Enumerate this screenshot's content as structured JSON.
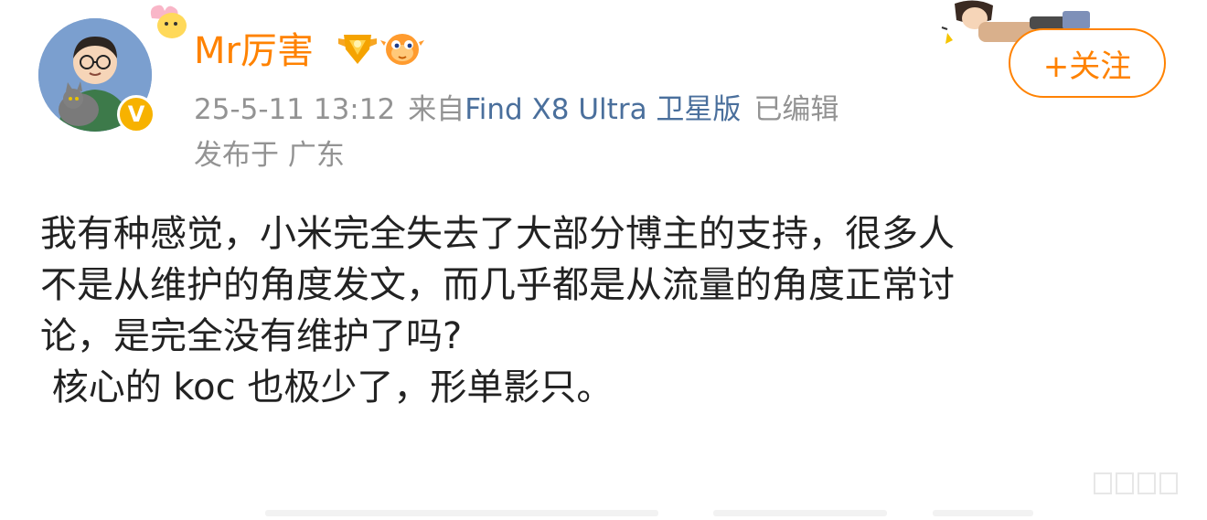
{
  "user": {
    "name": "Mr厉害",
    "verified_badge": "V",
    "badges": [
      "gold-wings-badge",
      "pufferfish-badge"
    ]
  },
  "meta": {
    "time": "25-5-11 13:12",
    "from_label": "来自",
    "device": "Find X8 Ultra 卫星版",
    "edited": "已编辑",
    "location": "发布于 广东"
  },
  "follow_button": {
    "label": "+关注"
  },
  "post": {
    "lines": [
      "我有种感觉，小米完全失去了大部分博主的支持，很多人",
      "不是从维护的角度发文，而几乎都是从流量的角度正常讨",
      "论，是完全没有维护了吗?",
      " 核心的 koc 也极少了，形单影只。"
    ]
  },
  "colors": {
    "accent": "#ff8200",
    "link": "#4a6f9c",
    "muted": "#939393",
    "text": "#222222"
  }
}
